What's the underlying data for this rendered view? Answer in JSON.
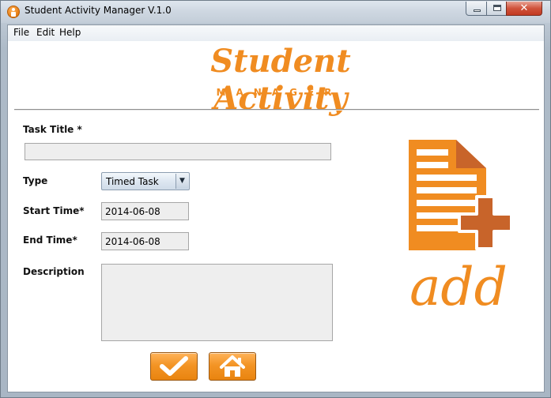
{
  "window": {
    "title": "Student Activity Manager V.1.0",
    "close_glyph": "✕"
  },
  "menu": [
    "File",
    "Edit",
    "Help"
  ],
  "logo": {
    "title": "Student Activity",
    "subtitle": "MANAGER"
  },
  "form": {
    "task_title_label": "Task Title *",
    "task_title_value": "",
    "type_label": "Type",
    "type_value": "Timed Task",
    "start_label": "Start Time*",
    "start_value": "2014-06-08",
    "end_label": "End Time*",
    "end_value": "2014-06-08",
    "description_label": "Description",
    "description_value": ""
  },
  "illustration": {
    "add_word": "add"
  },
  "icons": {
    "confirm": "checkmark-icon",
    "home": "home-icon",
    "document_add": "document-add-icon"
  },
  "colors": {
    "accent": "#f08c21",
    "accent_dark": "#c8642a"
  }
}
